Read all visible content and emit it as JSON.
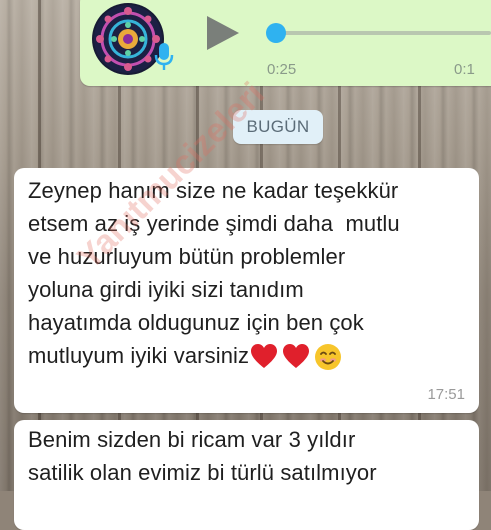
{
  "voice_message": {
    "elapsed": "0:25",
    "duration": "0:1",
    "progress": 0.0,
    "accent_color": "#2fb2f0",
    "bubble_color": "#dcf8c6",
    "play_icon": "play-icon",
    "mic_icon": "mic-icon"
  },
  "date_separator": "BUGÜN",
  "messages": [
    {
      "lines": [
        "Zeynep hanım size ne kadar teşekkür",
        "etsem az iş yerinde şimdi daha  mutlu",
        "ve huzurluyum bütün problemler",
        "yoluna girdi iyiki sizi tanıdım",
        "hayatımda oldugunuz için ben çok",
        "mutluyum iyiki varsiniz"
      ],
      "emojis": [
        "red-heart-icon",
        "red-heart-icon",
        "smiling-face-icon"
      ],
      "time": "17:51"
    },
    {
      "lines": [
        "Benim sizden bi ricam var 3 yıldır",
        "satilik olan evimiz bi türlü satılmıyor"
      ]
    }
  ],
  "watermark": "Yanıtmucizeleri"
}
